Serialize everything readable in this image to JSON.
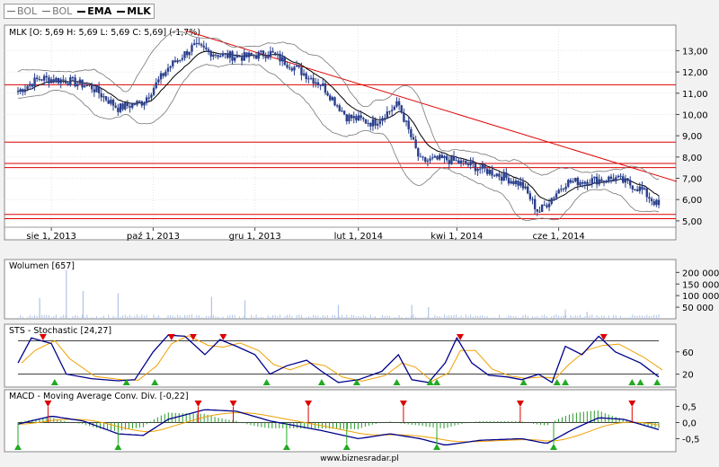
{
  "legend": [
    {
      "label": "BOL",
      "bold": false
    },
    {
      "label": "BOL",
      "bold": false
    },
    {
      "label": "EMA",
      "bold": true
    },
    {
      "label": "MLK",
      "bold": true
    }
  ],
  "footer": "www.biznesradar.pl",
  "colors": {
    "price": "#2a3f8c",
    "band": "#777777",
    "level_line": "#dd0000",
    "stoch_k": "#00008b",
    "stoch_d": "#f0a000",
    "hist_pos": "#2a9a2a",
    "hist_neg": "#2a9a2a",
    "volume": "#b0c4e8",
    "marker_sell": "#dd0000",
    "marker_buy": "#22aa22",
    "grid": "#cccccc"
  },
  "chart_data": [
    {
      "type": "candlestick",
      "title": "MLK [O: 5,69  H: 5,69  L: 5,69  C: 5,69] (-1,7%)",
      "x_labels": [
        "sie 1, 2013",
        "paź 1, 2013",
        "gru 1, 2013",
        "lut 1, 2014",
        "kwi 1, 2014",
        "cze 1, 2014"
      ],
      "y_ticks": [
        "5,00",
        "6,00",
        "7,00",
        "8,00",
        "9,00",
        "10,00",
        "11,00",
        "12,00",
        "13,00"
      ],
      "ylim": [
        4.7,
        14.2
      ],
      "horizontal_levels": [
        11.4,
        8.7,
        7.7,
        7.5,
        5.3,
        5.1
      ],
      "trendline": {
        "start": [
          "2013-10-20",
          13.95
        ],
        "end": [
          "2014-07-31",
          6.85
        ]
      },
      "close_path": [
        [
          "2013-07-12",
          11.1
        ],
        [
          "2013-07-25",
          11.7
        ],
        [
          "2013-08-10",
          11.6
        ],
        [
          "2013-08-25",
          11.3
        ],
        [
          "2013-09-10",
          10.3
        ],
        [
          "2013-09-25",
          10.6
        ],
        [
          "2013-10-10",
          12.2
        ],
        [
          "2013-10-25",
          13.2
        ],
        [
          "2013-11-10",
          12.8
        ],
        [
          "2013-11-25",
          12.7
        ],
        [
          "2013-12-10",
          12.9
        ],
        [
          "2013-12-25",
          12.2
        ],
        [
          "2014-01-10",
          11.4
        ],
        [
          "2014-01-25",
          9.9
        ],
        [
          "2014-02-10",
          9.6
        ],
        [
          "2014-02-25",
          10.5
        ],
        [
          "2014-03-10",
          7.8
        ],
        [
          "2014-03-25",
          7.9
        ],
        [
          "2014-04-10",
          7.6
        ],
        [
          "2014-04-25",
          7.2
        ],
        [
          "2014-05-10",
          6.7
        ],
        [
          "2014-05-20",
          5.4
        ],
        [
          "2014-06-05",
          6.8
        ],
        [
          "2014-06-20",
          6.9
        ],
        [
          "2014-07-05",
          7.0
        ],
        [
          "2014-07-20",
          6.5
        ],
        [
          "2014-07-31",
          5.69
        ]
      ]
    },
    {
      "type": "bar",
      "title": "Wolumen [657]",
      "y_ticks": [
        "200 000",
        "150 000",
        "100 000",
        "50 000"
      ],
      "ylim": [
        0,
        240000
      ],
      "spikes": [
        [
          "2013-08-10",
          210000
        ],
        [
          "2013-07-25",
          90000
        ],
        [
          "2013-08-20",
          120000
        ],
        [
          "2013-09-10",
          110000
        ],
        [
          "2013-11-05",
          95000
        ],
        [
          "2013-11-25",
          80000
        ],
        [
          "2014-01-20",
          60000
        ],
        [
          "2014-03-05",
          60000
        ],
        [
          "2014-03-15",
          50000
        ],
        [
          "2014-06-05",
          40000
        ],
        [
          "2014-06-18",
          30000
        ]
      ]
    },
    {
      "type": "line",
      "title": "STS - Stochastic [24,27]",
      "y_ticks": [
        "60",
        "20"
      ],
      "ylim": [
        0,
        100
      ],
      "levels": [
        80,
        20
      ],
      "k_path": [
        [
          "2013-07-12",
          40
        ],
        [
          "2013-07-20",
          85
        ],
        [
          "2013-08-01",
          75
        ],
        [
          "2013-08-10",
          20
        ],
        [
          "2013-08-25",
          12
        ],
        [
          "2013-09-10",
          8
        ],
        [
          "2013-09-20",
          10
        ],
        [
          "2013-10-01",
          60
        ],
        [
          "2013-10-10",
          90
        ],
        [
          "2013-10-20",
          88
        ],
        [
          "2013-11-01",
          55
        ],
        [
          "2013-11-10",
          82
        ],
        [
          "2013-11-20",
          70
        ],
        [
          "2013-12-01",
          55
        ],
        [
          "2013-12-10",
          20
        ],
        [
          "2013-12-20",
          35
        ],
        [
          "2014-01-01",
          45
        ],
        [
          "2014-01-10",
          25
        ],
        [
          "2014-01-20",
          5
        ],
        [
          "2014-02-01",
          10
        ],
        [
          "2014-02-15",
          25
        ],
        [
          "2014-02-25",
          55
        ],
        [
          "2014-03-05",
          10
        ],
        [
          "2014-03-15",
          5
        ],
        [
          "2014-03-25",
          40
        ],
        [
          "2014-04-01",
          85
        ],
        [
          "2014-04-10",
          40
        ],
        [
          "2014-04-20",
          18
        ],
        [
          "2014-05-01",
          15
        ],
        [
          "2014-05-10",
          10
        ],
        [
          "2014-05-20",
          20
        ],
        [
          "2014-05-28",
          5
        ],
        [
          "2014-06-05",
          70
        ],
        [
          "2014-06-15",
          55
        ],
        [
          "2014-06-25",
          88
        ],
        [
          "2014-07-05",
          60
        ],
        [
          "2014-07-20",
          40
        ],
        [
          "2014-07-31",
          15
        ]
      ],
      "sell_markers": [
        "2013-07-27",
        "2013-10-12",
        "2013-10-25",
        "2013-11-12",
        "2014-04-03",
        "2014-06-28"
      ],
      "buy_markers": [
        "2013-08-03",
        "2013-09-15",
        "2013-10-02",
        "2013-12-08",
        "2014-01-10",
        "2014-01-31",
        "2014-02-24",
        "2014-03-16",
        "2014-03-20",
        "2014-05-11",
        "2014-05-31",
        "2014-06-05",
        "2014-07-15",
        "2014-07-20",
        "2014-07-30"
      ]
    },
    {
      "type": "line",
      "title": "MACD - Moving Average Conv. Div. [-0,22]",
      "y_ticks": [
        "0,5",
        "0,0",
        "-0,5"
      ],
      "ylim": [
        -0.85,
        0.85
      ],
      "macd_path": [
        [
          "2013-07-12",
          -0.05
        ],
        [
          "2013-08-01",
          0.2
        ],
        [
          "2013-08-20",
          0.05
        ],
        [
          "2013-09-10",
          -0.35
        ],
        [
          "2013-09-25",
          -0.4
        ],
        [
          "2013-10-10",
          0.1
        ],
        [
          "2013-11-01",
          0.4
        ],
        [
          "2013-11-20",
          0.35
        ],
        [
          "2013-12-10",
          0.05
        ],
        [
          "2014-01-10",
          -0.25
        ],
        [
          "2014-02-01",
          -0.5
        ],
        [
          "2014-02-20",
          -0.35
        ],
        [
          "2014-03-10",
          -0.5
        ],
        [
          "2014-03-25",
          -0.7
        ],
        [
          "2014-04-15",
          -0.55
        ],
        [
          "2014-05-10",
          -0.5
        ],
        [
          "2014-05-25",
          -0.65
        ],
        [
          "2014-06-10",
          -0.2
        ],
        [
          "2014-06-25",
          0.15
        ],
        [
          "2014-07-10",
          0.1
        ],
        [
          "2014-07-31",
          -0.22
        ]
      ],
      "sell_markers": [
        "2013-07-30",
        "2013-10-28",
        "2013-11-18",
        "2014-01-02",
        "2014-02-28",
        "2014-05-09",
        "2014-07-15"
      ],
      "buy_markers": [
        "2013-07-12",
        "2013-09-10",
        "2013-12-20",
        "2014-01-25",
        "2014-03-20",
        "2014-05-29"
      ]
    }
  ]
}
